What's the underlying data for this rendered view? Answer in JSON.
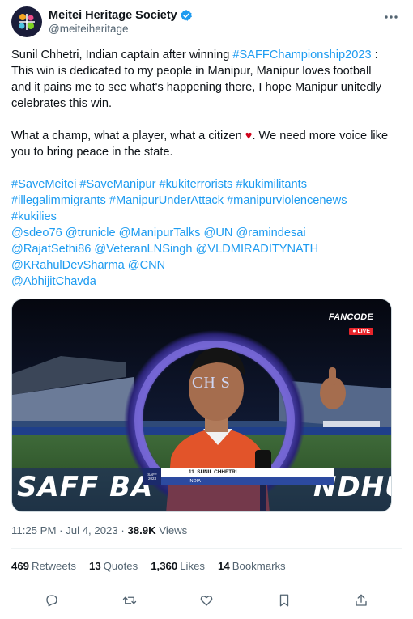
{
  "author": {
    "display_name": "Meitei Heritage Society",
    "handle": "@meiteiheritage",
    "verified": true
  },
  "tweet": {
    "line1_prefix": "Sunil Chhetri, Indian captain after winning ",
    "line1_hashtag": "#SAFFChampionship2023",
    "line1_suffix": " :",
    "line2": "This win is dedicated to my people in Manipur, Manipur loves football",
    "line3": "and it pains me to see what's happening there, I hope Manipur unitedly",
    "line4": "celebrates this win.",
    "line5_prefix": "What a champ, what a player, what a citizen ",
    "heart": "♥",
    "line5_suffix": ". We need more voice like",
    "line6": "you to bring peace in the state.",
    "tags_line1": "#SaveMeitei  #SaveManipur #kukiterrorists #kukimilitants",
    "tags_line2": "#illegalimmigrants #ManipurUnderAttack #manipurviolencenews",
    "tags_line3": "#kukilies",
    "mentions_line1": "@sdeo76 @trunicle @ManipurTalks @UN @ramindesai",
    "mentions_line2": "@RajatSethi86 @VeteranLNSingh @VLDMIRADITYNATH",
    "mentions_line3": "@KRahulDevSharma @CNN",
    "mentions_line4": "@AbhijitChavda"
  },
  "media": {
    "broadcaster": "FANCODE",
    "live_label": "● LIVE",
    "champions_text": "CH   S",
    "saff_text": "SAFF BA",
    "ndhu_text": "NDHU",
    "player_number_name": "11.   SUNIL CHHETRI",
    "player_country": "INDIA",
    "lt_logo_text": "SAFF 2023"
  },
  "meta": {
    "time": "11:25 PM",
    "separator": " · ",
    "date": "Jul 4, 2023",
    "views_count": "38.9K",
    "views_label": " Views"
  },
  "stats": {
    "retweets_count": "469",
    "retweets_label": "Retweets",
    "quotes_count": "13",
    "quotes_label": "Quotes",
    "likes_count": "1,360",
    "likes_label": "Likes",
    "bookmarks_count": "14",
    "bookmarks_label": "Bookmarks"
  },
  "colors": {
    "link": "#1d9bf0",
    "verified": "#1d9bf0",
    "heart": "#d0021b",
    "muted": "#536471"
  },
  "icons": [
    "logo-avatar-icon",
    "verified-badge-icon",
    "more-icon",
    "reply-icon",
    "retweet-icon",
    "like-icon",
    "bookmark-icon",
    "share-icon"
  ]
}
